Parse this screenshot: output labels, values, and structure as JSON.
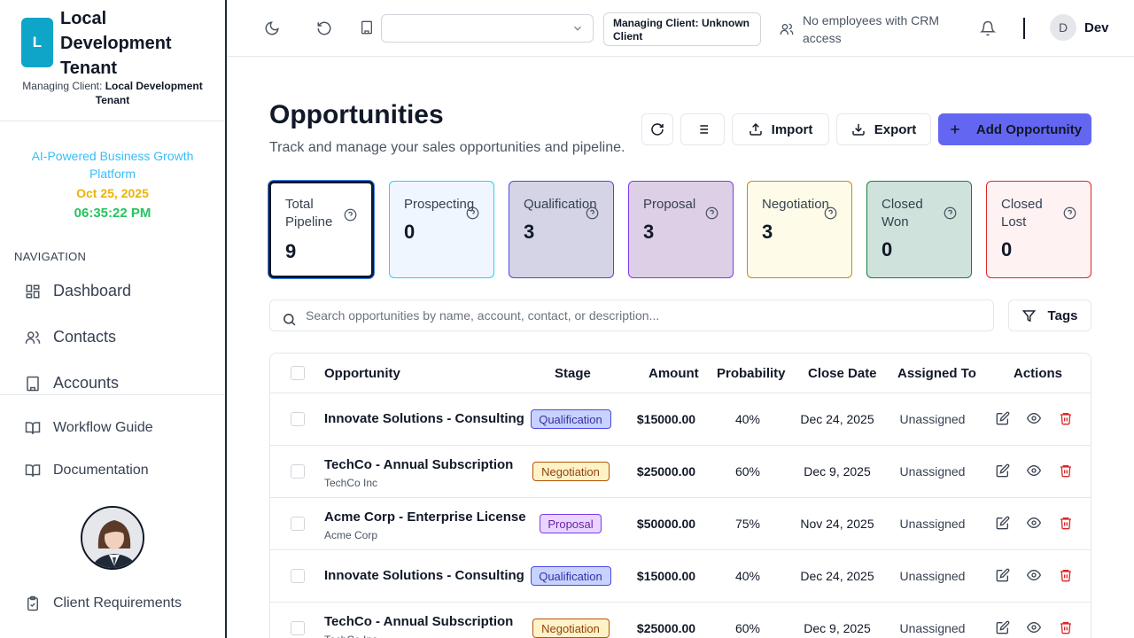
{
  "brand": {
    "logo_letter": "L",
    "name": "Local Development Tenant",
    "managing_label": "Managing Client:",
    "managing_value": "Local Development Tenant"
  },
  "sidebar": {
    "tagline": "AI-Powered Business Growth Platform",
    "date": "Oct 25, 2025",
    "time": "06:35:22 PM",
    "nav_heading": "NAVIGATION",
    "items": [
      {
        "label": "Dashboard",
        "icon": "dashboard-icon"
      },
      {
        "label": "Contacts",
        "icon": "users-icon"
      },
      {
        "label": "Accounts",
        "icon": "building-icon"
      }
    ],
    "bottom_items": [
      {
        "label": "Workflow Guide",
        "icon": "book-icon"
      },
      {
        "label": "Documentation",
        "icon": "book-icon"
      },
      {
        "label": "Client Requirements",
        "icon": "clipboard-icon"
      }
    ]
  },
  "topbar": {
    "tenant_select_value": "",
    "managing_client": "Managing Client: Unknown Client",
    "crm_status": "No employees with CRM access",
    "user_initial": "D",
    "user_name": "Dev"
  },
  "page": {
    "title": "Opportunities",
    "subtitle": "Track and manage your sales opportunities and pipeline."
  },
  "toolbar": {
    "import_label": "Import",
    "export_label": "Export",
    "add_label": "Add Opportunity"
  },
  "stats": [
    {
      "label": "Total Pipeline",
      "value": "9",
      "bg": "#ffffff",
      "border": "#111827"
    },
    {
      "label": "Prospecting",
      "value": "0",
      "bg": "#eff6ff",
      "border": "#22d3ee"
    },
    {
      "label": "Qualification",
      "value": "3",
      "bg": "#d4d4e6",
      "border": "#4f46e5"
    },
    {
      "label": "Proposal",
      "value": "3",
      "bg": "#ddcfe6",
      "border": "#7c3aed"
    },
    {
      "label": "Negotiation",
      "value": "3",
      "bg": "#fefce8",
      "border": "#ca8a04"
    },
    {
      "label": "Closed Won",
      "value": "0",
      "bg": "#cfe3dc",
      "border": "#15803d"
    },
    {
      "label": "Closed Lost",
      "value": "0",
      "bg": "#fef2f2",
      "border": "#dc2626"
    }
  ],
  "search": {
    "placeholder": "Search opportunities by name, account, contact, or description..."
  },
  "tags_label": "Tags",
  "table": {
    "headers": {
      "opportunity": "Opportunity",
      "stage": "Stage",
      "amount": "Amount",
      "probability": "Probability",
      "close_date": "Close Date",
      "assigned_to": "Assigned To",
      "actions": "Actions"
    },
    "rows": [
      {
        "name": "Innovate Solutions - Consulting",
        "account": "",
        "stage": "Qualification",
        "amount": "$15000.00",
        "probability": "40%",
        "close_date": "Dec 24, 2025",
        "assigned": "Unassigned"
      },
      {
        "name": "TechCo - Annual Subscription",
        "account": "TechCo Inc",
        "stage": "Negotiation",
        "amount": "$25000.00",
        "probability": "60%",
        "close_date": "Dec 9, 2025",
        "assigned": "Unassigned"
      },
      {
        "name": "Acme Corp - Enterprise License",
        "account": "Acme Corp",
        "stage": "Proposal",
        "amount": "$50000.00",
        "probability": "75%",
        "close_date": "Nov 24, 2025",
        "assigned": "Unassigned"
      },
      {
        "name": "Innovate Solutions - Consulting",
        "account": "",
        "stage": "Qualification",
        "amount": "$15000.00",
        "probability": "40%",
        "close_date": "Dec 24, 2025",
        "assigned": "Unassigned"
      },
      {
        "name": "TechCo - Annual Subscription",
        "account": "TechCo Inc",
        "stage": "Negotiation",
        "amount": "$25000.00",
        "probability": "60%",
        "close_date": "Dec 9, 2025",
        "assigned": "Unassigned"
      }
    ]
  },
  "stage_colors": {
    "Qualification": {
      "bg": "#c7d2fe",
      "border": "#4f46e5",
      "text": "#3730a3"
    },
    "Negotiation": {
      "bg": "#fef3c7",
      "border": "#b45309",
      "text": "#92400e"
    },
    "Proposal": {
      "bg": "#e9d5ff",
      "border": "#7c3aed",
      "text": "#6b21a8"
    }
  }
}
